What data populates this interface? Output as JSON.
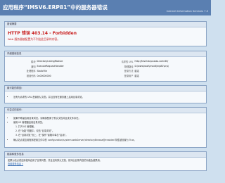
{
  "header": {
    "title": "应用程序“IMSV6.ERP81”中的服务器错误",
    "server_version": "Internet Information Services 7.5"
  },
  "error_summary": {
    "heading": "错误摘要",
    "title": "HTTP 错误 403.14 - Forbidden",
    "description": "Web 服务器被配置为不列出此目录的内容。"
  },
  "details": {
    "heading": "详细错误信息",
    "rows": [
      {
        "label": "模块",
        "value": "DirectoryListingModule",
        "label2": "请求的 URL",
        "value2": "http://test.tianpuxiao.com:80/"
      },
      {
        "label": "通知",
        "value": "ExecuteRequestHandler",
        "label2": "物理路径",
        "value2": "D:\\www\\root\\imsv6\\erp81\\erp\\"
      },
      {
        "label": "处理程序",
        "value": "StaticFile",
        "label2": "登录方法",
        "value2": "匿名"
      },
      {
        "label": "错误代码",
        "value": "0x00000000",
        "label2": "登录用户",
        "value2": "匿名"
      }
    ]
  },
  "likely_causes": {
    "heading": "最可能的原因:",
    "items": [
      "没有为请求的 URL 配置默认文档，并且没有在服务器上启用目录浏览。"
    ]
  },
  "things_to_try": {
    "heading": "可尝试的操作:",
    "items": [
      "如果不希望启用目录浏览，请确保配置了默认文档并且该文件存在。",
      "使用 IIS 管理器启用目录浏览。"
    ],
    "steps": [
      "打开 IIS 管理器。",
      "在“功能”视图中，双击“目录浏览”。",
      "在“目录浏览”页上，在“操作”窗格中单击“启用”。"
    ],
    "extra": "确认站点或应用程序配置文件中的 configuration/system.webServer/directoryBrowse@enabled 特性被设置为 True。"
  },
  "links": {
    "heading": "链接和更多信息",
    "text": "如果为站点或应用程序启用了目录列表，并且没有默认文档，则列出目录内容的功能会被禁用。",
    "link_text": "查看更多信息 »"
  },
  "colors": {
    "header_bg": "#5a7fb1",
    "page_bg": "#cfe0ef",
    "error_red": "#c81b1b"
  }
}
